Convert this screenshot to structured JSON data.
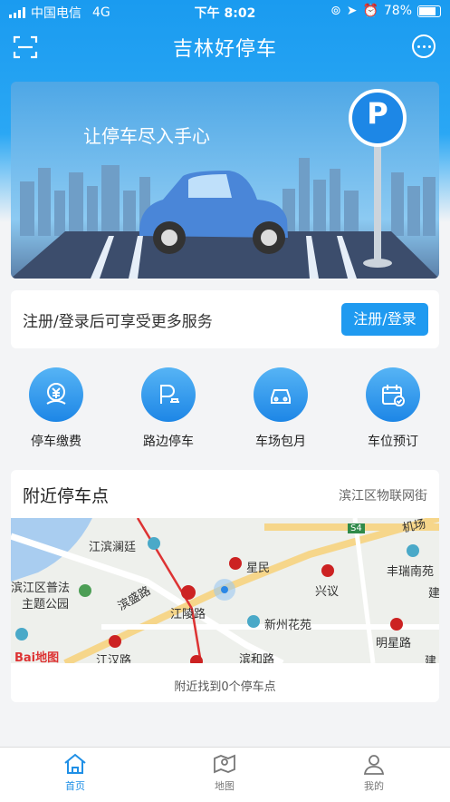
{
  "status_bar": {
    "carrier": "中国电信",
    "network": "4G",
    "time": "下午 8:02",
    "battery": "78%"
  },
  "nav": {
    "title": "吉林好停车"
  },
  "banner": {
    "slogan": "让停车尽入手心",
    "sign_letter": "P"
  },
  "login": {
    "prompt": "注册/登录后可享受更多服务",
    "button": "注册/登录"
  },
  "services": [
    {
      "label": "停车缴费",
      "icon": "yuan-coin-icon"
    },
    {
      "label": "路边停车",
      "icon": "roadside-parking-icon"
    },
    {
      "label": "车场包月",
      "icon": "car-icon"
    },
    {
      "label": "车位预订",
      "icon": "calendar-check-icon"
    }
  ],
  "nearby": {
    "title": "附近停车点",
    "location": "滨江区物联网街",
    "footer": "附近找到0个停车点",
    "map_labels": [
      "江滨澜廷",
      "滨盛路",
      "江陵路",
      "星民",
      "兴议",
      "丰瑞南苑",
      "滨江区普法",
      "主题公园",
      "新州花苑",
      "明星路",
      "江汉路",
      "滨和路",
      "S4",
      "机场",
      "建",
      "建"
    ],
    "map_logo": "Bai地图"
  },
  "tabs": [
    {
      "label": "首页",
      "active": true
    },
    {
      "label": "地图",
      "active": false
    },
    {
      "label": "我的",
      "active": false
    }
  ]
}
